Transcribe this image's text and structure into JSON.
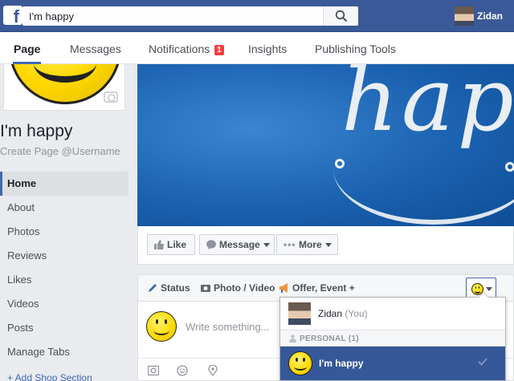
{
  "topbar": {
    "logo": "f",
    "search_value": "I'm happy",
    "search_placeholder": "Search",
    "user_name": "Zidan"
  },
  "tabs": [
    {
      "label": "Page",
      "active": true
    },
    {
      "label": "Messages"
    },
    {
      "label": "Notifications",
      "badge": "1"
    },
    {
      "label": "Insights"
    },
    {
      "label": "Publishing Tools"
    }
  ],
  "page": {
    "name": "I'm happy",
    "username_prompt": "Create Page @Username"
  },
  "nav": {
    "items": [
      "Home",
      "About",
      "Photos",
      "Reviews",
      "Likes",
      "Videos",
      "Posts",
      "Manage Tabs"
    ],
    "active": "Home",
    "add_shop": "+ Add Shop Section"
  },
  "cover": {
    "text": "happ"
  },
  "actions": {
    "like": "Like",
    "message": "Message",
    "more": "More"
  },
  "composer": {
    "tabs": [
      "Status",
      "Photo / Video",
      "Offer, Event +"
    ],
    "placeholder": "Write something..."
  },
  "poster_dropdown": {
    "user_name": "Zidan",
    "user_suffix": "(You)",
    "section_label": "PERSONAL (1)",
    "selected_name": "I'm happy"
  },
  "colors": {
    "brand": "#3b5998",
    "selected": "#365899",
    "badge": "#fa3e3e"
  }
}
